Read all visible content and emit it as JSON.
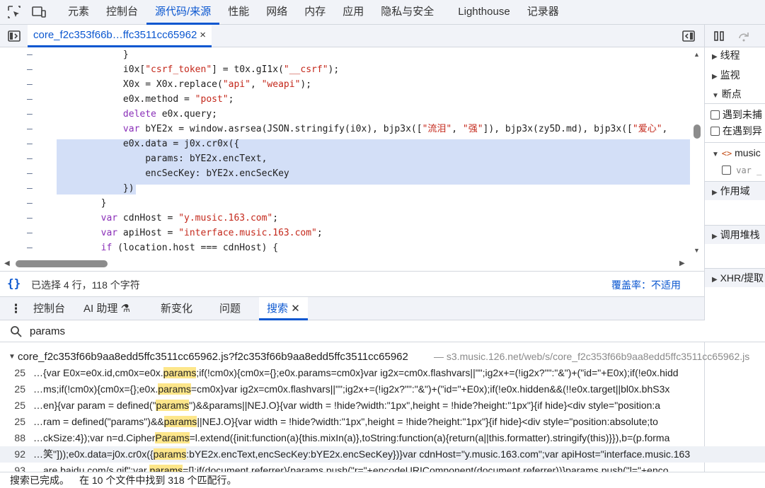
{
  "main_tabs": [
    "元素",
    "控制台",
    "源代码/来源",
    "性能",
    "网络",
    "内存",
    "应用",
    "隐私与安全",
    "Lighthouse",
    "记录器"
  ],
  "file_tab": {
    "label": "core_f2c353f66b…ffc3511cc65962",
    "close": "×"
  },
  "code_lines": [
    {
      "gutter": "–",
      "text": "            }"
    },
    {
      "gutter": "–",
      "text": "            i0x[\"csrf_token\"] = t0x.gI1x(\"__csrf\");"
    },
    {
      "gutter": "–",
      "text": "            X0x = X0x.replace(\"api\", \"weapi\");"
    },
    {
      "gutter": "–",
      "text": "            e0x.method = \"post\";"
    },
    {
      "gutter": "–",
      "text": "            delete e0x.query;"
    },
    {
      "gutter": "–",
      "text": "            var bYE2x = window.asrsea(JSON.stringify(i0x), bjp3x([\"流泪\", \"强\"]), bjp3x(zy5D.md), bjp3x([\"爱心\","
    },
    {
      "gutter": "–",
      "text": "            e0x.data = j0x.cr0x({"
    },
    {
      "gutter": "–",
      "text": "                params: bYE2x.encText,"
    },
    {
      "gutter": "–",
      "text": "                encSecKey: bYE2x.encSecKey"
    },
    {
      "gutter": "–",
      "text": "            })"
    },
    {
      "gutter": "–",
      "text": "        }"
    },
    {
      "gutter": "–",
      "text": "        var cdnHost = \"y.music.163.com\";"
    },
    {
      "gutter": "–",
      "text": "        var apiHost = \"interface.music.163.com\";"
    },
    {
      "gutter": "–",
      "text": "        if (location.host === cdnHost) {"
    }
  ],
  "status": {
    "selection": "已选择 4 行，118 个字符",
    "coverage": "覆盖率：不适用"
  },
  "sidebar": {
    "threads": "线程",
    "watch": "监视",
    "breakpoints": "断点",
    "pause_uncaught": "遇到未捕",
    "pause_caught": "在遇到异",
    "music_label": "music",
    "var_label": "var _",
    "scope": "作用域",
    "call_stack": "调用堆栈",
    "xhr": "XHR/提取"
  },
  "drawer_tabs": {
    "console": "控制台",
    "ai": "AI 助理",
    "whats_new": "新变化",
    "issues": "问题",
    "search": "搜索"
  },
  "search": {
    "query": "params"
  },
  "results": {
    "file": "core_f2c353f66b9aa8edd5ffc3511cc65962.js?f2c353f66b9aa8edd5ffc3511cc65962",
    "url": "— s3.music.126.net/web/s/core_f2c353f66b9aa8edd5ffc3511cc65962.js",
    "lines": [
      {
        "num": "25",
        "pre": "…{var E0x=e0x.id,cm0x=e0x.",
        "hl": "params",
        "post": ";if(!cm0x){cm0x={};e0x.params=cm0x}var ig2x=cm0x.flashvars||\"\";ig2x+=(!ig2x?\"\":\"&\")+(\"id=\"+E0x);if(!e0x.hidd"
      },
      {
        "num": "25",
        "pre": "…ms;if(!cm0x){cm0x={};e0x.",
        "hl": "params",
        "post": "=cm0x}var ig2x=cm0x.flashvars||\"\";ig2x+=(!ig2x?\"\":\"&\")+(\"id=\"+E0x);if(!e0x.hidden&&(!!e0x.target||bl0x.bhS3x"
      },
      {
        "num": "25",
        "pre": "…en}{var param = defined(\"",
        "hl": "params",
        "post": "\")&&params||NEJ.O}{var width = !hide?width:\"1px\",height = !hide?height:\"1px\"}{if hide}<div style=\"position:a"
      },
      {
        "num": "25",
        "pre": "…ram = defined(\"params\")&&",
        "hl": "params",
        "post": "||NEJ.O}{var width = !hide?width:\"1px\",height = !hide?height:\"1px\"}{if hide}<div style=\"position:absolute;to"
      },
      {
        "num": "88",
        "pre": "…ckSize:4});var n=d.Cipher",
        "hl": "Params",
        "post": "=l.extend({init:function(a){this.mixIn(a)},toString:function(a){return(a||this.formatter).stringify(this)}}),b=(p.forma"
      },
      {
        "num": "92",
        "pre": "…笑\"]));e0x.data=j0x.cr0x({",
        "hl": "params",
        "post": ":bYE2x.encText,encSecKey:bYE2x.encSecKey})}var cdnHost=\"y.music.163.com\";var apiHost=\"interface.music.163"
      },
      {
        "num": "93",
        "pre": "…are.baidu.com/s.gif\";var ",
        "hl": "params",
        "post": "=[];if(document.referrer){params.push(\"r=\"+encodeURIComponent(document.referrer))}params.push(\"l=\"+enco"
      }
    ]
  },
  "footer": {
    "done": "搜索已完成。",
    "summary": "在 10 个文件中找到 318 个匹配行。"
  },
  "colors": {
    "accent": "#0b57d0",
    "selection": "#d3dff7",
    "highlight": "#fde68a",
    "toolbar": "#f1f3f8"
  }
}
